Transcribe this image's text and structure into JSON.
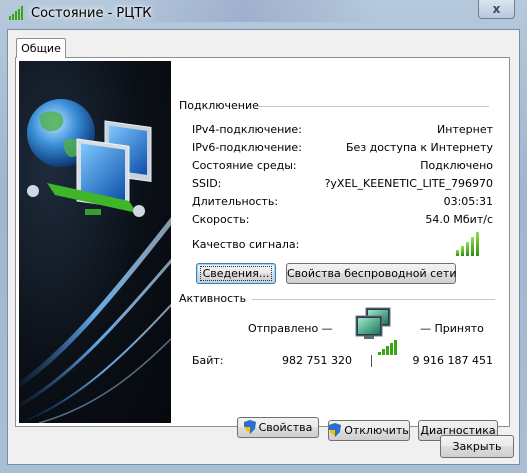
{
  "window": {
    "title": "Состояние - РЦТК",
    "close_glyph": "x"
  },
  "tabs": [
    {
      "label": "Общие"
    }
  ],
  "connection": {
    "section_title": "Подключение",
    "rows": [
      {
        "label": "IPv4-подключение:",
        "value": "Интернет"
      },
      {
        "label": "IPv6-подключение:",
        "value": "Без доступа к Интернету"
      },
      {
        "label": "Состояние среды:",
        "value": "Подключено"
      },
      {
        "label": "SSID:",
        "value": "?yXEL_KEENETIC_LITE_796970"
      },
      {
        "label": "Длительность:",
        "value": "03:05:31"
      },
      {
        "label": "Скорость:",
        "value": "54.0 Мбит/с"
      }
    ],
    "signal_label": "Качество сигнала:",
    "signal_level": 5,
    "signal_max": 5,
    "details_button": "Сведения...",
    "wireless_props_button": "Свойства беспроводной сети"
  },
  "activity": {
    "section_title": "Активность",
    "sent_label": "Отправлено —",
    "received_label": "— Принято",
    "bytes_label": "Байт:",
    "bytes_sent": "982 751 320",
    "bytes_received": "9 916 187 451",
    "properties_button": "Свойства",
    "disconnect_button": "Отключить",
    "diagnostics_button": "Диагностика"
  },
  "footer": {
    "close_button": "Закрыть"
  },
  "colors": {
    "signal_green": "#3aa616",
    "focus_blue": "#3c7fb1"
  },
  "icons": [
    "wireless-signal-icon",
    "network-globe-computer-icon",
    "network-computers-icon",
    "uac-shield-icon",
    "close-icon"
  ]
}
